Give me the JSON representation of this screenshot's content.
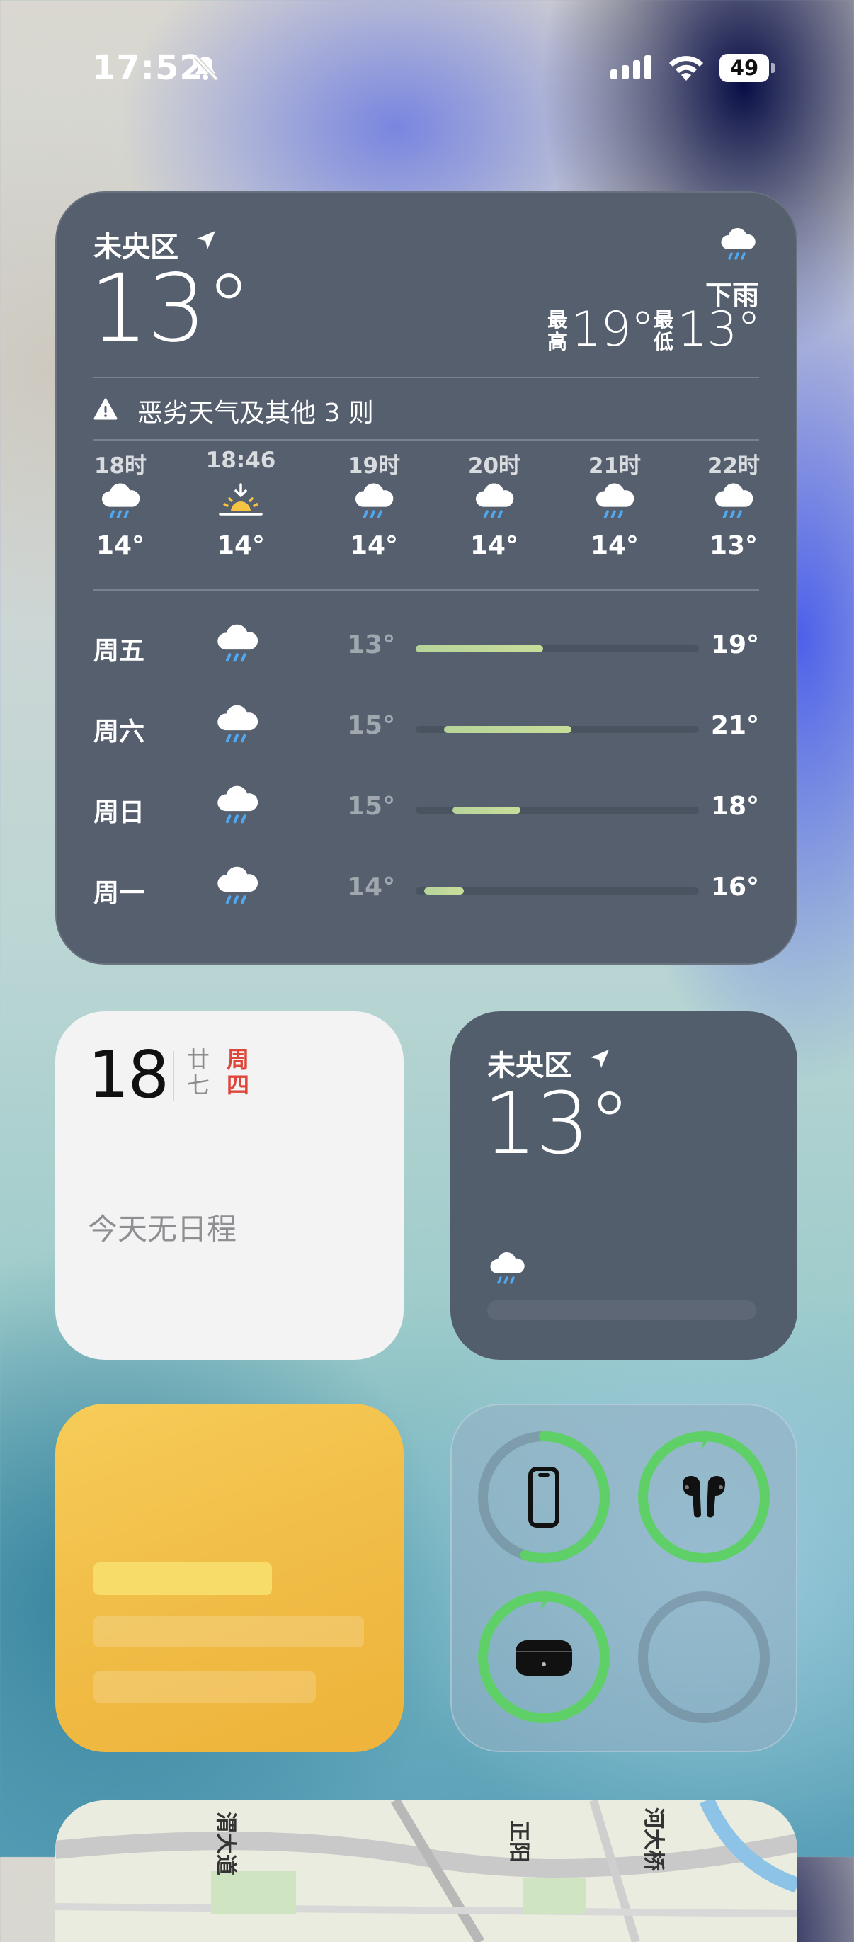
{
  "status_bar": {
    "time": "17:52",
    "battery_level": "49",
    "icons": [
      "bell-slash-icon",
      "cellular-signal-icon",
      "wifi-icon",
      "battery-icon"
    ]
  },
  "weather_large": {
    "location": "未央区",
    "current_temp": "13°",
    "condition": "下雨",
    "high_label": "最高",
    "high": "19°",
    "low_label": "最低",
    "low": "13°",
    "alert": "恶劣天气及其他 3 则",
    "hourly": [
      {
        "time": "18时",
        "icon": "rain-cloud-icon",
        "temp": "14°"
      },
      {
        "time": "18:46",
        "icon": "sunset-icon",
        "temp": "14°"
      },
      {
        "time": "19时",
        "icon": "rain-cloud-icon",
        "temp": "14°"
      },
      {
        "time": "20时",
        "icon": "rain-cloud-icon",
        "temp": "14°"
      },
      {
        "time": "21时",
        "icon": "rain-cloud-icon",
        "temp": "14°"
      },
      {
        "time": "22时",
        "icon": "rain-cloud-icon",
        "temp": "13°"
      }
    ],
    "daily": [
      {
        "day": "周五",
        "icon": "rain-cloud-icon",
        "low": "13°",
        "high": "19°",
        "range_start": 0.0,
        "range_end": 0.45
      },
      {
        "day": "周六",
        "icon": "rain-cloud-icon",
        "low": "15°",
        "high": "21°",
        "range_start": 0.1,
        "range_end": 0.55
      },
      {
        "day": "周日",
        "icon": "rain-cloud-icon",
        "low": "15°",
        "high": "18°",
        "range_start": 0.13,
        "range_end": 0.37
      },
      {
        "day": "周一",
        "icon": "rain-cloud-icon",
        "low": "14°",
        "high": "16°",
        "range_start": 0.03,
        "range_end": 0.17
      }
    ]
  },
  "calendar": {
    "date": "18",
    "lunar_top": "廿",
    "lunar_bottom": "七",
    "weekday_top": "周",
    "weekday_bottom": "四",
    "no_events": "今天无日程"
  },
  "weather_small": {
    "location": "未央区",
    "temp": "13°"
  },
  "batteries": {
    "devices": [
      {
        "name": "iphone-icon",
        "level": 0.55,
        "charging": false
      },
      {
        "name": "airpods-icon",
        "level": 1.0,
        "charging": true
      },
      {
        "name": "airpods-case-icon",
        "level": 1.0,
        "charging": true
      },
      {
        "name": "empty-slot",
        "level": 0,
        "charging": false
      }
    ],
    "accent": "#5fd068"
  },
  "map": {
    "labels": [
      "渭大道",
      "正阳",
      "河大桥"
    ]
  }
}
